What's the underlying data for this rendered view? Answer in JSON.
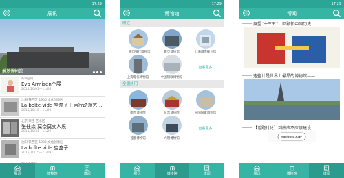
{
  "status": {
    "time": "17:29"
  },
  "colors": {
    "accent": "#36b5a5",
    "accent_dark": "#2b9b8d"
  },
  "icons": {
    "avatar": "person-icon",
    "search": "search-icon",
    "tab_news": "building-icon",
    "tab_museum": "museum-icon",
    "tab_info": "news-icon"
  },
  "tabs": [
    "展讯",
    "博物馆",
    "博闻"
  ],
  "screen1": {
    "title": "展讯",
    "hero_caption": "爵基博物馆",
    "news": [
      {
        "sub": "A/N空间",
        "title": "Eva Armisén个展",
        "date": "2015/10/01—11/06"
      },
      {
        "sub": "沈阳 铁西区 1905 文化创意园",
        "title": "La boîte vide 空盒子｜后行动派艺术小...",
        "date": "2015/10/15—11/09"
      },
      {
        "sub": "北京 宋庄 艺术区",
        "title": "张往森 莫奈莫奕人展",
        "date": "2015/10/31—11/29"
      },
      {
        "sub": "沈阳 铁西区 1905 文化创意园",
        "title": "La boîte vide 空盒子",
        "date": "2015/10/15—11/09"
      },
      {
        "sub": "浙江美术馆",
        "title": "",
        "date": ""
      }
    ]
  },
  "screen2": {
    "title": "博物馆",
    "nearby_label": "附近",
    "nearby": [
      "上海市银行博物馆",
      "震旦博物馆",
      "上海城市规划馆",
      "上海电信博物馆",
      "中国银联博物馆"
    ],
    "hot_label": "全国热门",
    "hot": [
      "南京博物院",
      "故宫博物院",
      "中国国家博物馆",
      "首都博物馆",
      "六朝博物馆"
    ],
    "more": "查看更多"
  },
  "screen3": {
    "title": "博闻",
    "articles": [
      "展望“十三五”，回顾新中国历史...",
      "这些计是世界上最昂的博物馆——",
      "【话题讨论】到底应不应该建设...",
      "博物馆到底不建?"
    ]
  }
}
